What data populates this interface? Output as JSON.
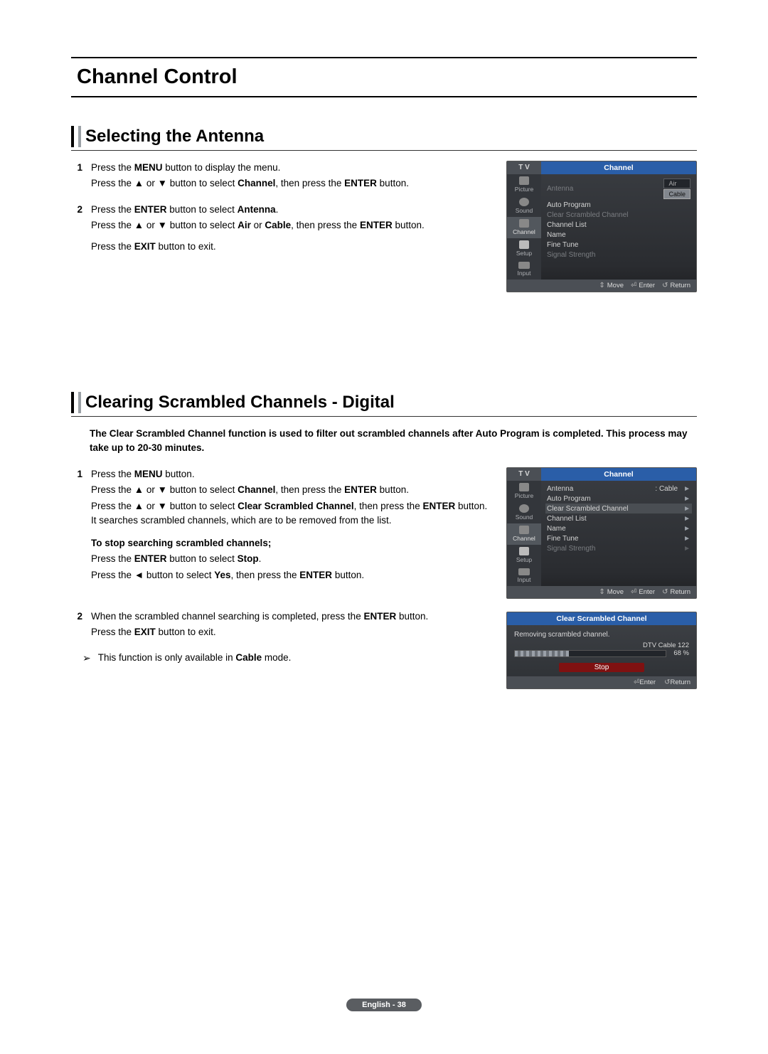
{
  "chapterTitle": "Channel Control",
  "sectionA": {
    "heading": "Selecting the Antenna",
    "steps": [
      {
        "num": "1",
        "lines": [
          [
            {
              "t": "Press the "
            },
            {
              "t": "MENU",
              "b": true
            },
            {
              "t": " button to display the menu."
            }
          ],
          [
            {
              "t": "Press the ▲ or ▼ button to select "
            },
            {
              "t": "Channel",
              "b": true
            },
            {
              "t": ", then press the "
            },
            {
              "t": "ENTER",
              "b": true
            },
            {
              "t": " button."
            }
          ]
        ]
      },
      {
        "num": "2",
        "lines": [
          [
            {
              "t": "Press the "
            },
            {
              "t": "ENTER",
              "b": true
            },
            {
              "t": " button to select "
            },
            {
              "t": "Antenna",
              "b": true
            },
            {
              "t": "."
            }
          ],
          [
            {
              "t": "Press the ▲ or ▼ button to select "
            },
            {
              "t": "Air",
              "b": true
            },
            {
              "t": " or "
            },
            {
              "t": "Cable",
              "b": true
            },
            {
              "t": ", then press the "
            },
            {
              "t": "ENTER",
              "b": true
            },
            {
              "t": " button."
            }
          ],
          [
            {
              "t": "Press the "
            },
            {
              "t": "EXIT",
              "b": true
            },
            {
              "t": " button to exit."
            }
          ]
        ]
      }
    ],
    "osd": {
      "tv": "T V",
      "title": "Channel",
      "sidebar": [
        "Picture",
        "Sound",
        "Channel",
        "Setup",
        "Input"
      ],
      "activeIndex": 2,
      "rows": [
        {
          "label": "Antenna",
          "dim": true,
          "antennaOpts": {
            "air": "Air",
            "cable": "Cable",
            "sel": "cable"
          }
        },
        {
          "label": "Auto Program",
          "dim": false
        },
        {
          "label": "Clear Scrambled Channel",
          "dim": true
        },
        {
          "label": "Channel List",
          "dim": false
        },
        {
          "label": "Name",
          "dim": false
        },
        {
          "label": "Fine Tune",
          "dim": false
        },
        {
          "label": "Signal Strength",
          "dim": true
        }
      ],
      "footer": {
        "move": "Move",
        "enter": "Enter",
        "ret": "Return"
      }
    }
  },
  "sectionB": {
    "heading": "Clearing Scrambled Channels - Digital",
    "intro": "The Clear Scrambled Channel function is used to filter out scrambled channels after Auto Program is completed. This process may take up to 20-30 minutes.",
    "steps1": {
      "num": "1",
      "lines": [
        [
          {
            "t": "Press the "
          },
          {
            "t": "MENU",
            "b": true
          },
          {
            "t": " button."
          }
        ],
        [
          {
            "t": "Press the ▲ or ▼ button to select "
          },
          {
            "t": "Channel",
            "b": true
          },
          {
            "t": ", then press the "
          },
          {
            "t": "ENTER",
            "b": true
          },
          {
            "t": " button."
          }
        ],
        [
          {
            "t": "Press the ▲ or ▼ button to select "
          },
          {
            "t": "Clear Scrambled Channel",
            "b": true
          },
          {
            "t": ", then press the "
          },
          {
            "t": "ENTER",
            "b": true
          },
          {
            "t": " button. It searches scrambled channels, which are to be removed from the list."
          }
        ]
      ],
      "sub": {
        "heading": "To stop searching scrambled channels;",
        "lines": [
          [
            {
              "t": "Press the "
            },
            {
              "t": "ENTER",
              "b": true
            },
            {
              "t": " button to select "
            },
            {
              "t": "Stop",
              "b": true
            },
            {
              "t": "."
            }
          ],
          [
            {
              "t": "Press the ◄ button to select "
            },
            {
              "t": "Yes",
              "b": true
            },
            {
              "t": ", then press the "
            },
            {
              "t": "ENTER",
              "b": true
            },
            {
              "t": " button."
            }
          ]
        ]
      }
    },
    "steps2": {
      "num": "2",
      "lines": [
        [
          {
            "t": "When the scrambled channel searching is completed, press the "
          },
          {
            "t": "ENTER",
            "b": true
          },
          {
            "t": " button."
          }
        ],
        [
          {
            "t": "Press the "
          },
          {
            "t": "EXIT",
            "b": true
          },
          {
            "t": " button to exit."
          }
        ]
      ]
    },
    "note": [
      {
        "t": "This function is only available in "
      },
      {
        "t": "Cable",
        "b": true
      },
      {
        "t": " mode."
      }
    ],
    "osd": {
      "tv": "T V",
      "title": "Channel",
      "sidebar": [
        "Picture",
        "Sound",
        "Channel",
        "Setup",
        "Input"
      ],
      "activeIndex": 2,
      "rows": [
        {
          "label": "Antenna",
          "value": ": Cable",
          "arrow": true
        },
        {
          "label": "Auto Program",
          "arrow": true
        },
        {
          "label": "Clear Scrambled Channel",
          "hl": true,
          "arrow": true
        },
        {
          "label": "Channel List",
          "arrow": true
        },
        {
          "label": "Name",
          "arrow": true
        },
        {
          "label": "Fine Tune",
          "arrow": true
        },
        {
          "label": "Signal Strength",
          "dim": true,
          "dimarrow": true
        }
      ],
      "footer": {
        "move": "Move",
        "enter": "Enter",
        "ret": "Return"
      }
    },
    "dialog": {
      "title": "Clear Scrambled Channel",
      "msg": "Removing scrambled channel.",
      "prog": "DTV Cable 122",
      "pct": "68 %",
      "fill": 36,
      "stop": "Stop",
      "footer": {
        "enter": "Enter",
        "ret": "Return"
      }
    }
  },
  "pageNum": "English - 38",
  "icons": {
    "updown": "⇕",
    "enter": "⏎",
    "ret": "↺"
  }
}
